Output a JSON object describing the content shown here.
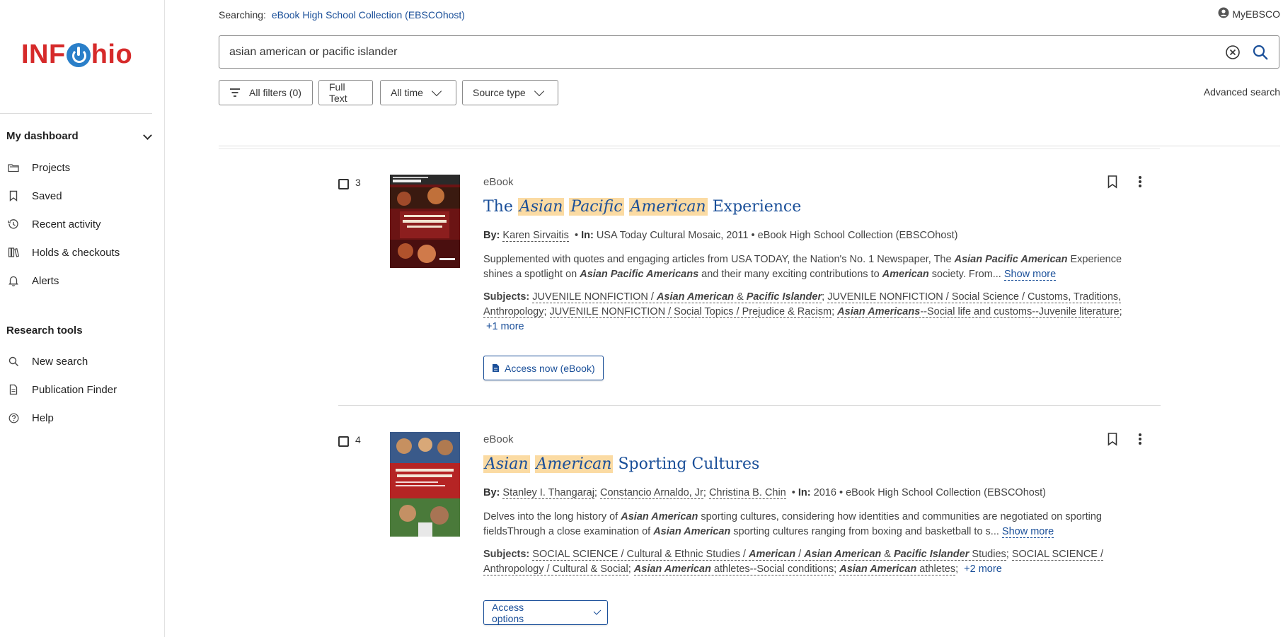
{
  "sidebar": {
    "logo": {
      "left": "INF",
      "right": "hio"
    },
    "dashboard_heading": "My dashboard",
    "dashboard_items": [
      {
        "label": "Projects",
        "icon": "folder-icon"
      },
      {
        "label": "Saved",
        "icon": "bookmark-icon"
      },
      {
        "label": "Recent activity",
        "icon": "history-icon"
      },
      {
        "label": "Holds & checkouts",
        "icon": "books-icon"
      },
      {
        "label": "Alerts",
        "icon": "bell-icon"
      }
    ],
    "tools_heading": "Research tools",
    "tools_items": [
      {
        "label": "New search",
        "icon": "search-icon"
      },
      {
        "label": "Publication Finder",
        "icon": "document-icon"
      },
      {
        "label": "Help",
        "icon": "help-icon"
      }
    ]
  },
  "header": {
    "searching_label": "Searching:",
    "searching_db": "eBook High School Collection (EBSCOhost)",
    "account_label": "MyEBSCO",
    "search_value": "asian american or pacific islander",
    "filters": {
      "all_filters": "All filters (0)",
      "full_text": "Full Text",
      "date": "All time",
      "source_type": "Source type"
    },
    "advanced_search": "Advanced search"
  },
  "results": [
    {
      "number": "3",
      "type": "eBook",
      "title_hl": [
        "Asian",
        "Pacific",
        "American"
      ],
      "title_rest": "Experience",
      "title_prefix": "The",
      "by_label": "By:",
      "authors": [
        "Karen Sirvaitis"
      ],
      "in_label": "In:",
      "source": "USA Today Cultural Mosaic, 2011",
      "collection": "eBook High School Collection (EBSCOhost)",
      "abstract": "Supplemented with quotes and engaging articles from USA TODAY, the Nation's No. 1 Newspaper, The Asian Pacific American Experience shines a spotlight on Asian Pacific Americans and their many exciting contributions to American society. From...",
      "show_more": "Show more",
      "subjects_label": "Subjects:",
      "more_subjects": "+1 more",
      "access_label": "Access now (eBook)",
      "cover_title": "The Asian Pacific American Experience",
      "cover_series": "USA TODAY CULTURAL MOSAIC"
    },
    {
      "number": "4",
      "type": "eBook",
      "title_hl": [
        "Asian",
        "American"
      ],
      "title_rest": "Sporting Cultures",
      "by_label": "By:",
      "authors": [
        "Stanley I. Thangaraj",
        "Constancio Arnaldo, Jr",
        "Christina B. Chin"
      ],
      "in_label": "In:",
      "source": "2016",
      "collection": "eBook High School Collection (EBSCOhost)",
      "abstract": "Delves into the long history of Asian American sporting cultures, considering how identities and communities are negotiated on sporting fieldsThrough a close examination of Asian American sporting cultures ranging from boxing and basketball to s...",
      "show_more": "Show more",
      "subjects_label": "Subjects:",
      "more_subjects": "+2 more",
      "access_label": "Access options",
      "cover_title": "ASIAN AMERICAN SPORTING CULTURES"
    }
  ],
  "colors": {
    "link": "#1a4f99",
    "highlight": "#fbdba3",
    "logo_red": "#d62a2a",
    "logo_blue": "#2a7fc9"
  }
}
